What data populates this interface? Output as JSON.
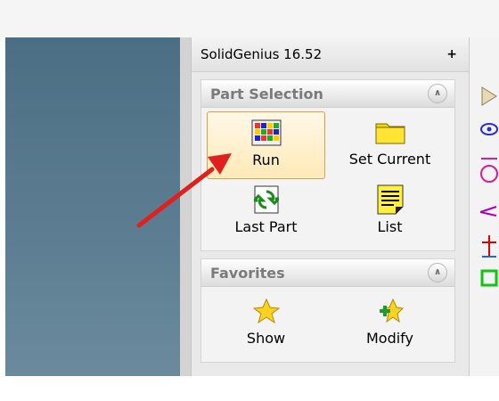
{
  "panel": {
    "title": "SolidGenius 16.52",
    "pin_icon": "pin-icon"
  },
  "part_selection": {
    "title": "Part Selection",
    "tools": [
      {
        "label": "Run",
        "icon": "color-grid-icon",
        "selected": true
      },
      {
        "label": "Set Current",
        "icon": "folder-icon"
      },
      {
        "label": "Last Part",
        "icon": "refresh-icon"
      },
      {
        "label": "List",
        "icon": "list-icon"
      }
    ]
  },
  "favorites": {
    "title": "Favorites",
    "tools": [
      {
        "label": "Show",
        "icon": "star-icon"
      },
      {
        "label": "Modify",
        "icon": "star-plus-icon"
      }
    ]
  },
  "annotation": {
    "arrow_color": "#e0201c"
  },
  "colors": {
    "viewport": "#5a7a8e",
    "selected_tool": "#ffe9b8"
  }
}
